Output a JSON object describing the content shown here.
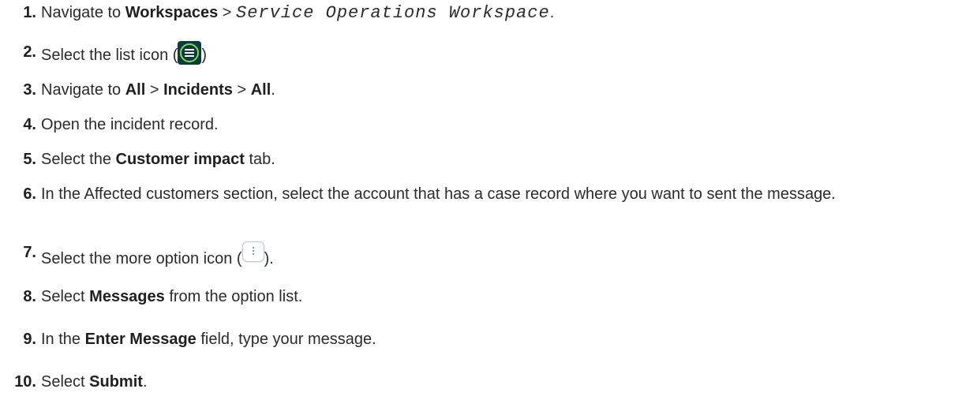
{
  "steps": [
    {
      "num": "1.",
      "parts": [
        "Navigate to ",
        "Workspaces",
        " > ",
        "Service Operations Workspace",
        "."
      ]
    },
    {
      "num": "2.",
      "parts": [
        "Select the list icon (",
        ")"
      ],
      "icon": "list-icon"
    },
    {
      "num": "3.",
      "parts": [
        "Navigate to ",
        "All",
        " > ",
        "Incidents",
        " > ",
        "All",
        "."
      ]
    },
    {
      "num": "4.",
      "parts": [
        "Open the incident record."
      ]
    },
    {
      "num": "5.",
      "parts": [
        "Select the ",
        "Customer impact",
        " tab."
      ]
    },
    {
      "num": "6.",
      "parts": [
        "In the Affected customers section, select the account that has a case record where you want to sent the message."
      ]
    },
    {
      "num": "7.",
      "parts": [
        "Select the more option icon (",
        ")."
      ],
      "icon": "more-options-icon"
    },
    {
      "num": "8.",
      "parts": [
        "Select ",
        "Messages",
        " from the option list."
      ]
    },
    {
      "num": "9.",
      "parts": [
        "In the ",
        "Enter Message",
        " field, type your message."
      ]
    },
    {
      "num": "10.",
      "parts": [
        "Select ",
        "Submit",
        "."
      ]
    }
  ],
  "colors": {
    "text": "#2b2b2b",
    "list_icon_bg": "#0d3a3c",
    "list_icon_ring": "#7fd957",
    "more_icon_border": "#b8c7d6"
  }
}
